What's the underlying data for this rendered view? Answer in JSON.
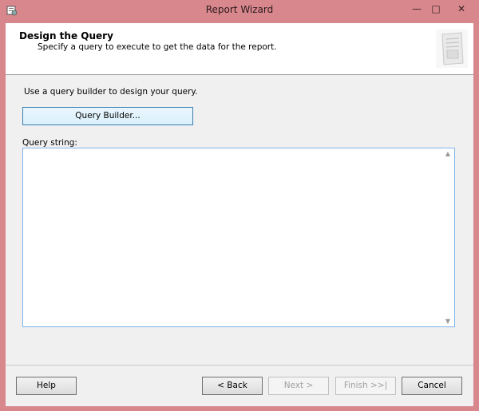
{
  "window": {
    "title": "Report Wizard",
    "controls": {
      "minimize": "—",
      "maximize": "□",
      "close": "✕"
    }
  },
  "header": {
    "title": "Design the Query",
    "subtitle": "Specify a query to execute to get the data for the report."
  },
  "main": {
    "instruction": "Use a query builder to design your query.",
    "query_builder_label": "Query Builder...",
    "query_string_label": "Query string:",
    "query_string_value": ""
  },
  "footer": {
    "help_label": "Help",
    "back_label": "< Back",
    "next_label": "Next >",
    "finish_label": "Finish >>|",
    "cancel_label": "Cancel"
  },
  "colors": {
    "frame": "#d8878d",
    "client_bg": "#f0f0f0",
    "focus_border": "#7eb4ea"
  }
}
